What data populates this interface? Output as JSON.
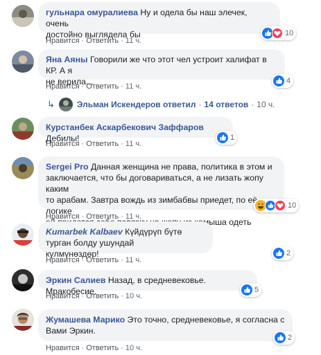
{
  "action_labels": {
    "like": "Нравится",
    "reply": "Ответить"
  },
  "comments": [
    {
      "author": "гульнара омуралиева",
      "text_line1": "Ну и одела бы наш элечек, очень",
      "text_line2": "достойно выглядела бы",
      "time": "11 ч.",
      "reaction_count": "10",
      "reaction_icons": [
        "like-icon",
        "love-icon"
      ]
    },
    {
      "author": "Яна Аяны",
      "text_line1": "Говорили же что этот чел устроит халифат в КР. А я",
      "text_line2": "не верила...",
      "time": "11 ч.",
      "reaction_count": "4",
      "reaction_icons": [
        "like-icon"
      ],
      "replies_summary": {
        "replier": "Эльман Искендеров ответил",
        "count": "14 ответов",
        "time": "10 ч."
      }
    },
    {
      "author": "Курстанбек Аскарбекович Заффаров",
      "text_line1": "Дебилы!",
      "time": "11 ч.",
      "reaction_count": "1",
      "reaction_icons": [
        "like-icon"
      ]
    },
    {
      "author": "Sergei Pro",
      "text_line1": "Данная женщина не права, политика в этом и",
      "text_line2": "заключается, что бы договариваться, а не лизать жопу каким",
      "text_line3": "то арабам. Завтра вождь из зимбабвы приедет, по её логике",
      "text_line4": "ей придется себе повязку на жопу из камыша одеть",
      "time": "11 ч.",
      "reaction_count": "10",
      "reaction_icons": [
        "haha-icon",
        "like-icon",
        "love-icon"
      ]
    },
    {
      "author": "Kumarbek Kalbaev",
      "text_line1": "Күйдүрүп бүтө турган болду ушундай",
      "text_line2": "күлмүнөздөр!",
      "time": "11 ч.",
      "reaction_count": "2",
      "reaction_icons": [
        "like-icon"
      ]
    },
    {
      "author": "Эркин Салиев",
      "text_line1": "Назад, в средневековье. Мракобесие.",
      "time": "10 ч.",
      "reaction_count": "5",
      "reaction_icons": [
        "like-icon"
      ]
    },
    {
      "author": "Жумашева Марико",
      "text_line1": "Это точно, средневековье, я согласна с",
      "text_line2": "Вами Эркин.",
      "time": "10 ч.",
      "reaction_count": "2",
      "reaction_icons": [
        "like-icon"
      ]
    }
  ],
  "colors": {
    "author": "#385898",
    "bubble": "#f2f3f5",
    "like": "#1877f2",
    "love": "#f33e58",
    "haha": "#f7b125"
  }
}
